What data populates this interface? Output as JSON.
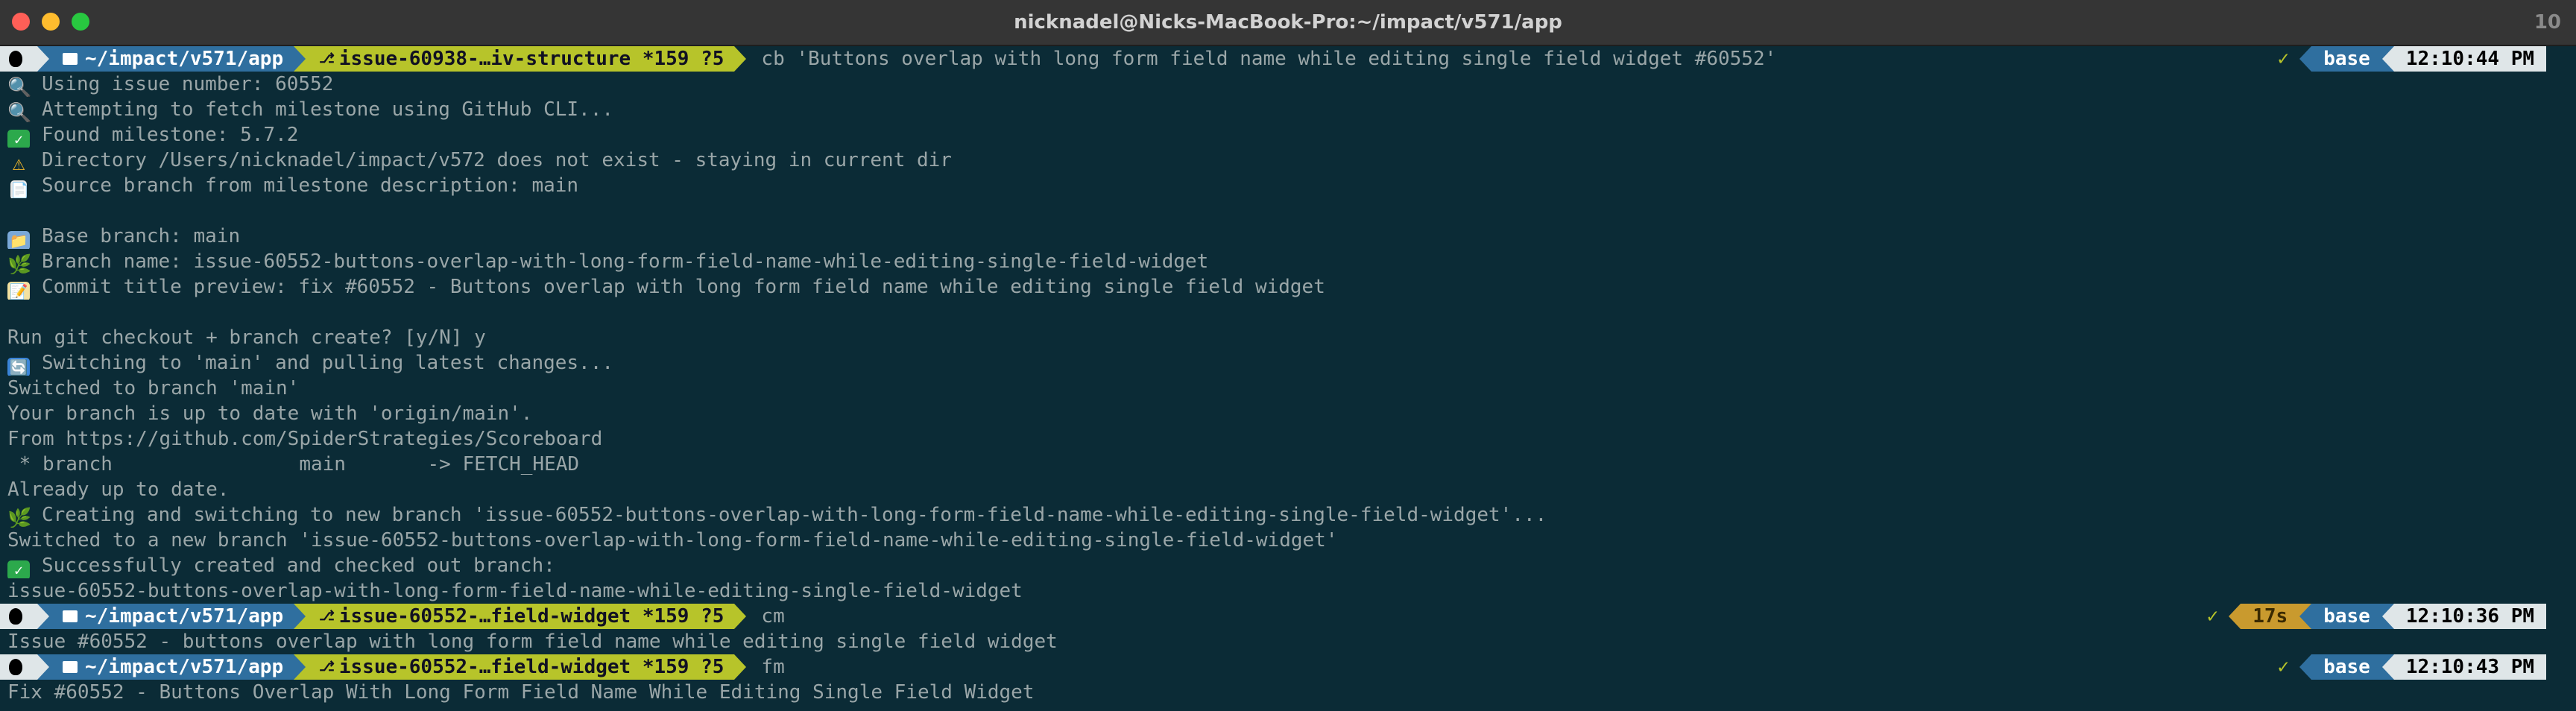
{
  "window": {
    "title": "nicknadel@Nicks-MacBook-Pro:~/impact/v571/app",
    "count": "10"
  },
  "prompt1": {
    "path": "~/impact/v571/app",
    "git": "issue-60938-…iv-structure *159 ?5",
    "command": "cb 'Buttons overlap with long form field name while editing single field widget #60552'",
    "status": "✓",
    "env": "base",
    "time": "12:10:44 PM"
  },
  "output1": [
    {
      "icon": "🔍",
      "text": "Using issue number: 60552"
    },
    {
      "icon": "🔍",
      "text": "Attempting to fetch milestone using GitHub CLI..."
    },
    {
      "icon": "✓",
      "text": "Found milestone: 5.7.2"
    },
    {
      "icon": "⚠",
      "text": "Directory /Users/nicknadel/impact/v572 does not exist - staying in current dir"
    },
    {
      "icon": "📄",
      "text": "Source branch from milestone description: main"
    },
    {
      "icon": "",
      "text": ""
    },
    {
      "icon": "📁",
      "text": "Base branch: main"
    },
    {
      "icon": "🌿",
      "text": "Branch name: issue-60552-buttons-overlap-with-long-form-field-name-while-editing-single-field-widget"
    },
    {
      "icon": "📝",
      "text": "Commit title preview: fix #60552 - Buttons overlap with long form field name while editing single field widget"
    },
    {
      "icon": "",
      "text": ""
    },
    {
      "icon": "",
      "text": "Run git checkout + branch create? [y/N] y"
    },
    {
      "icon": "🔄",
      "text": "Switching to 'main' and pulling latest changes..."
    },
    {
      "icon": "",
      "text": "Switched to branch 'main'"
    },
    {
      "icon": "",
      "text": "Your branch is up to date with 'origin/main'."
    },
    {
      "icon": "",
      "text": "From https://github.com/SpiderStrategies/Scoreboard"
    },
    {
      "icon": "",
      "text": " * branch                main       -> FETCH_HEAD"
    },
    {
      "icon": "",
      "text": "Already up to date."
    },
    {
      "icon": "🌿",
      "text": "Creating and switching to new branch 'issue-60552-buttons-overlap-with-long-form-field-name-while-editing-single-field-widget'..."
    },
    {
      "icon": "",
      "text": "Switched to a new branch 'issue-60552-buttons-overlap-with-long-form-field-name-while-editing-single-field-widget'"
    },
    {
      "icon": "✓",
      "text": "Successfully created and checked out branch:"
    },
    {
      "icon": "",
      "text": "issue-60552-buttons-overlap-with-long-form-field-name-while-editing-single-field-widget"
    }
  ],
  "prompt2": {
    "path": "~/impact/v571/app",
    "git": "issue-60552-…field-widget *159 ?5",
    "command": "cm",
    "status": "✓",
    "duration": "17s",
    "env": "base",
    "time": "12:10:36 PM"
  },
  "output2": "Issue #60552 - buttons overlap with long form field name while editing single field widget",
  "prompt3": {
    "path": "~/impact/v571/app",
    "git": "issue-60552-…field-widget *159 ?5",
    "command": "fm",
    "status": "✓",
    "env": "base",
    "time": "12:10:43 PM"
  },
  "output3": "Fix #60552 - Buttons Overlap With Long Form Field Name While Editing Single Field Widget"
}
